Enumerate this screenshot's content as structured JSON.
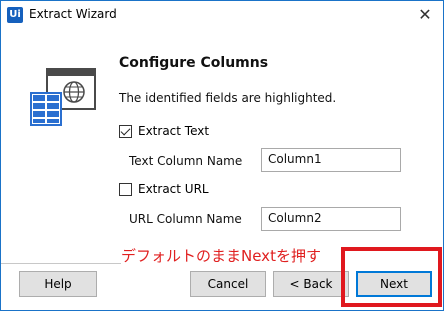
{
  "window": {
    "title": "Extract Wizard",
    "app_icon_label": "Ui",
    "close_glyph": "✕"
  },
  "header": {
    "title": "Configure Columns",
    "subtitle": "The identified fields are highlighted."
  },
  "extract_text": {
    "label": "Extract Text",
    "checked": true,
    "column_label": "Text Column Name",
    "column_value": "Column1"
  },
  "extract_url": {
    "label": "Extract URL",
    "checked": false,
    "column_label": "URL Column Name",
    "column_value": "Column2"
  },
  "annotation": {
    "text": "デフォルトのままNextを押す",
    "color": "#e02020"
  },
  "buttons": {
    "help": "Help",
    "cancel": "Cancel",
    "back": "< Back",
    "next": "Next"
  },
  "colors": {
    "accent": "#1560bd",
    "highlight": "#e0181e"
  }
}
